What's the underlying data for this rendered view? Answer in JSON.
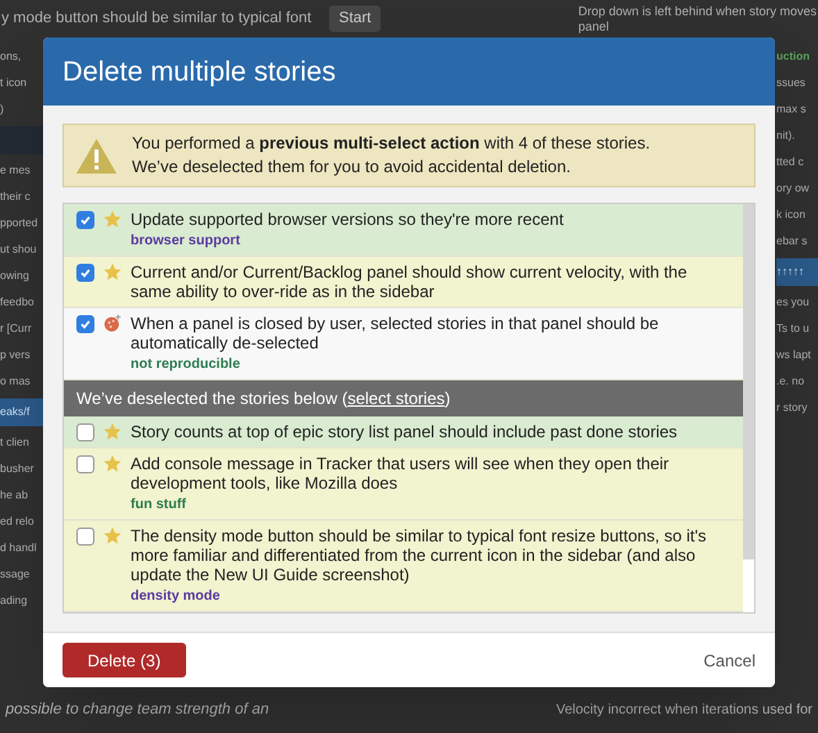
{
  "background": {
    "top_left": "y mode button should be similar to typical font",
    "start_button": "Start",
    "top_right": [
      "Drop down is left behind when story moves",
      "panel"
    ],
    "left_fragments": [
      {
        "kind": "story",
        "text": "ons,"
      },
      {
        "kind": "story",
        "text": "t icon"
      },
      {
        "kind": "story",
        "text": ")"
      },
      {
        "kind": "header"
      },
      {
        "kind": "story",
        "text": "e mes"
      },
      {
        "kind": "story",
        "text": "their c"
      },
      {
        "kind": "story",
        "text": "pported"
      },
      {
        "kind": "story",
        "text": "ut shou"
      },
      {
        "kind": "story",
        "text": "owing"
      },
      {
        "kind": "story",
        "text": "feedbo"
      },
      {
        "kind": "story",
        "text": "r [Curr"
      },
      {
        "kind": "story",
        "text": "p vers"
      },
      {
        "kind": "story",
        "text": "o mas"
      },
      {
        "kind": "highlight",
        "text": "eaks/f"
      },
      {
        "kind": "story",
        "text": "t clien"
      },
      {
        "kind": "story",
        "text": "busher"
      },
      {
        "kind": "story",
        "text": "he ab"
      },
      {
        "kind": "story",
        "text": "ed relo"
      },
      {
        "kind": "story",
        "text": "d handl"
      },
      {
        "kind": "story",
        "text": "ssage"
      },
      {
        "kind": "story",
        "text": "ading"
      }
    ],
    "right_fragments": [
      {
        "kind": "label",
        "text": "uction"
      },
      {
        "kind": "story",
        "text": "ssues"
      },
      {
        "kind": "story",
        "text": "max s"
      },
      {
        "kind": "story",
        "text": "nit)."
      },
      {
        "kind": "story",
        "text": "tted c"
      },
      {
        "kind": "story",
        "text": "ory ow"
      },
      {
        "kind": "story",
        "text": "k icon"
      },
      {
        "kind": "story",
        "text": "ebar s"
      },
      {
        "kind": "highlight",
        "text": "↑↑↑↑↑"
      },
      {
        "kind": "story",
        "text": "es you"
      },
      {
        "kind": "story",
        "text": "Ts to u"
      },
      {
        "kind": "story",
        "text": "ws lapt"
      },
      {
        "kind": "story",
        "text": ".e. no"
      },
      {
        "kind": "story",
        "text": "r story"
      }
    ],
    "bottom_left": "possible to change team strength of an",
    "bottom_right": "Velocity incorrect when iterations used for"
  },
  "dialog": {
    "title": "Delete multiple stories",
    "warning": [
      "You performed a **previous multi-select action** with 4 of these stories.",
      "We’ve deselected them for you to avoid accidental deletion."
    ],
    "selected_stories": [
      {
        "checked": true,
        "kind": "feature",
        "title": "Update supported browser versions so they're more recent",
        "label": {
          "text": "browser support",
          "color": "#5b3aa0"
        },
        "color": "#d9ebd0"
      },
      {
        "checked": true,
        "kind": "feature",
        "title": "Current and/or Current/Backlog panel should show current velocity, with the same ability to over-ride as in the sidebar",
        "color": "#f2f3cf"
      },
      {
        "checked": true,
        "kind": "bug",
        "title": "When a panel is closed by user, selected stories in that panel should be automatically de-selected",
        "label": {
          "text": "not reproducible",
          "color": "#2e7d4f"
        },
        "color": "#f8f8f8"
      }
    ],
    "deselected_header": {
      "text": "We’ve deselected the stories below (",
      "link": "select stories",
      "suffix": ")"
    },
    "deselected_stories": [
      {
        "checked": false,
        "kind": "feature",
        "title": "Story counts at top of epic story list panel should include past done stories",
        "color": "#d9ebd0"
      },
      {
        "checked": false,
        "kind": "feature",
        "title": "Add console message in Tracker that users will see when they open their development tools, like Mozilla does",
        "label": {
          "text": "fun stuff",
          "color": "#2e7d4f"
        },
        "color": "#f2f3cf"
      },
      {
        "checked": false,
        "kind": "feature",
        "title": "The density mode button should be similar to typical font resize buttons, so it's more familiar and differentiated from the current icon in the sidebar (and also update the New UI Guide screenshot)",
        "label": {
          "text": "density mode",
          "color": "#5b3aa0"
        },
        "color": "#f2f3cf"
      }
    ],
    "delete_button": "Delete (3)",
    "cancel_button": "Cancel"
  }
}
